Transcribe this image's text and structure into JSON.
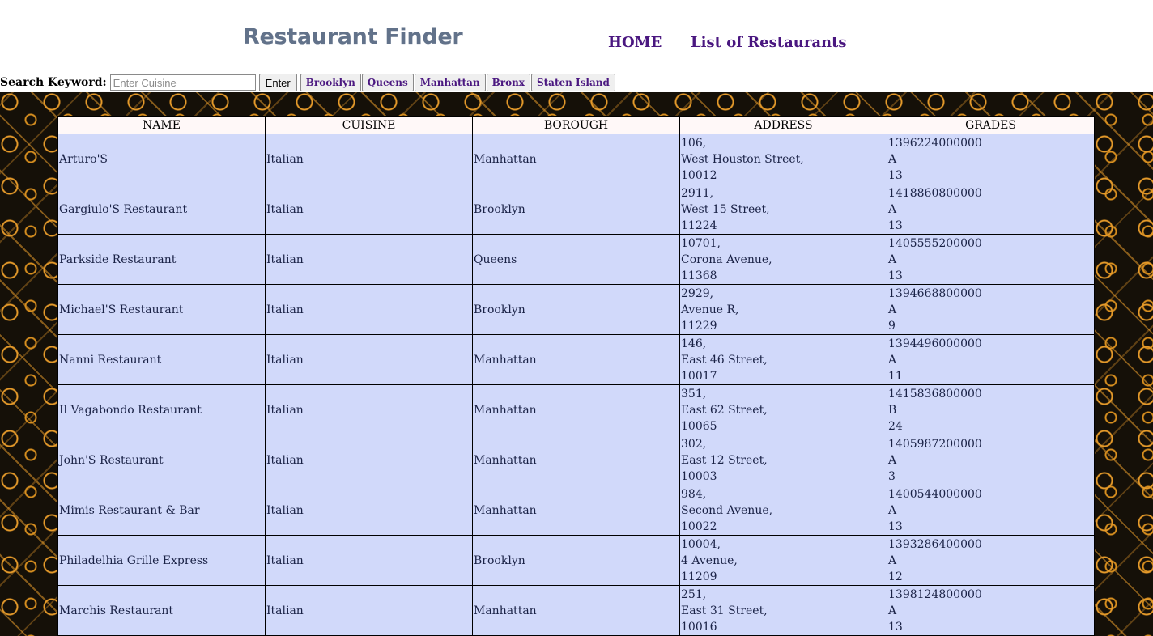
{
  "header": {
    "title": "Restaurant Finder",
    "nav": [
      {
        "label": "HOME"
      },
      {
        "label": "List of Restaurants"
      }
    ]
  },
  "search": {
    "label": "Search Keyword:",
    "placeholder": "Enter Cuisine",
    "value": "",
    "enter_label": "Enter",
    "boroughs": [
      "Brooklyn",
      "Queens",
      "Manhattan",
      "Bronx",
      "Staten Island"
    ]
  },
  "table": {
    "columns": [
      "NAME",
      "CUISINE",
      "BOROUGH",
      "ADDRESS",
      "GRADES"
    ],
    "rows": [
      {
        "name": "Arturo'S",
        "cuisine": "Italian",
        "borough": "Manhattan",
        "address": [
          "106,",
          "West Houston Street,",
          "10012"
        ],
        "grades": [
          "1396224000000",
          "A",
          "13"
        ]
      },
      {
        "name": "Gargiulo'S Restaurant",
        "cuisine": "Italian",
        "borough": "Brooklyn",
        "address": [
          "2911,",
          "West 15 Street,",
          "11224"
        ],
        "grades": [
          "1418860800000",
          "A",
          "13"
        ]
      },
      {
        "name": "Parkside Restaurant",
        "cuisine": "Italian",
        "borough": "Queens",
        "address": [
          "10701,",
          "Corona Avenue,",
          "11368"
        ],
        "grades": [
          "1405555200000",
          "A",
          "13"
        ]
      },
      {
        "name": "Michael'S Restaurant",
        "cuisine": "Italian",
        "borough": "Brooklyn",
        "address": [
          "2929,",
          "Avenue R,",
          "11229"
        ],
        "grades": [
          "1394668800000",
          "A",
          "9"
        ]
      },
      {
        "name": "Nanni Restaurant",
        "cuisine": "Italian",
        "borough": "Manhattan",
        "address": [
          "146,",
          "East 46 Street,",
          "10017"
        ],
        "grades": [
          "1394496000000",
          "A",
          "11"
        ]
      },
      {
        "name": "Il Vagabondo Restaurant",
        "cuisine": "Italian",
        "borough": "Manhattan",
        "address": [
          "351,",
          "East 62 Street,",
          "10065"
        ],
        "grades": [
          "1415836800000",
          "B",
          "24"
        ]
      },
      {
        "name": "John'S Restaurant",
        "cuisine": "Italian",
        "borough": "Manhattan",
        "address": [
          "302,",
          "East 12 Street,",
          "10003"
        ],
        "grades": [
          "1405987200000",
          "A",
          "3"
        ]
      },
      {
        "name": "Mimis Restaurant & Bar",
        "cuisine": "Italian",
        "borough": "Manhattan",
        "address": [
          "984,",
          "Second Avenue,",
          "10022"
        ],
        "grades": [
          "1400544000000",
          "A",
          "13"
        ]
      },
      {
        "name": "Philadelhia Grille Express",
        "cuisine": "Italian",
        "borough": "Brooklyn",
        "address": [
          "10004,",
          "4 Avenue,",
          "11209"
        ],
        "grades": [
          "1393286400000",
          "A",
          "12"
        ]
      },
      {
        "name": "Marchis Restaurant",
        "cuisine": "Italian",
        "borough": "Manhattan",
        "address": [
          "251,",
          "East 31 Street,",
          "10016"
        ],
        "grades": [
          "1398124800000",
          "A",
          "13"
        ]
      }
    ]
  },
  "colors": {
    "title": "#62728a",
    "nav": "#4a1780",
    "header_row": "#fff8f8",
    "body_row": "#d1d9fa",
    "pattern_dark": "#151008",
    "pattern_accent": "#e59a2a"
  }
}
